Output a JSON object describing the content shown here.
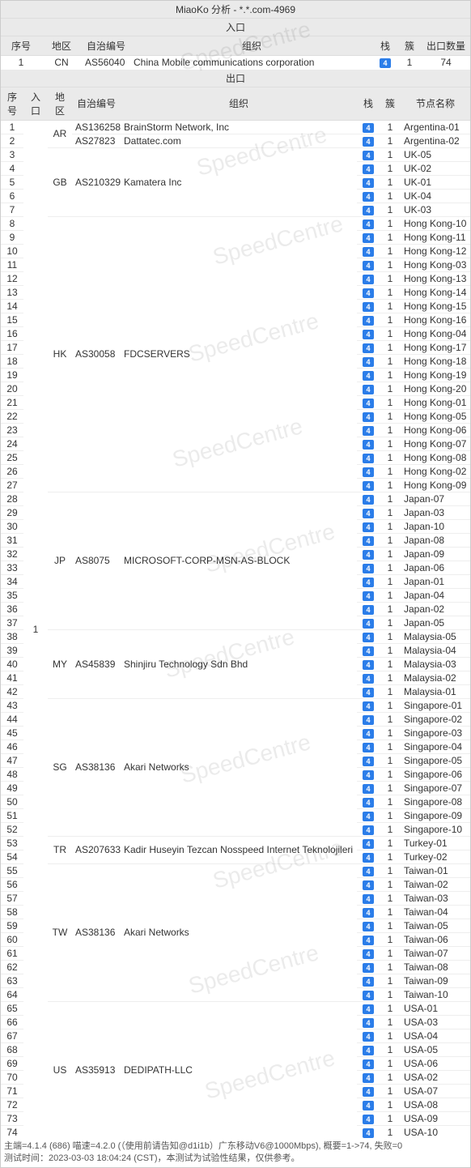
{
  "title": "MiaoKo 分析 - *.*.com-4969",
  "watermark_text": "SpeedCentre",
  "entry_section": {
    "label": "入口"
  },
  "exit_section": {
    "label": "出口"
  },
  "entry_headers": {
    "seq": "序号",
    "region": "地区",
    "asn": "自治编号",
    "org": "组织",
    "stack": "栈",
    "clan": "簇",
    "exit_count": "出口数量"
  },
  "exit_headers": {
    "seq": "序号",
    "entry": "入口",
    "region": "地区",
    "asn": "自治编号",
    "org": "组织",
    "stack": "栈",
    "clan": "簇",
    "node": "节点名称"
  },
  "badge_value": "4",
  "entry_rows": [
    {
      "seq": "1",
      "region": "CN",
      "asn": "AS56040",
      "org": "China Mobile communications corporation",
      "clan": "1",
      "exit_count": "74"
    }
  ],
  "exit_entry_value": "1",
  "region_groups": [
    {
      "region": "AR",
      "subs": [
        {
          "asn": "AS136258",
          "org": "BrainStorm Network, Inc",
          "rows": [
            {
              "seq": "1",
              "clan": "1",
              "node": "Argentina-01"
            }
          ]
        },
        {
          "asn": "AS27823",
          "org": "Dattatec.com",
          "rows": [
            {
              "seq": "2",
              "clan": "1",
              "node": "Argentina-02"
            }
          ]
        }
      ]
    },
    {
      "region": "GB",
      "subs": [
        {
          "asn": "AS210329",
          "org": "Kamatera Inc",
          "rows": [
            {
              "seq": "3",
              "clan": "1",
              "node": "UK-05"
            },
            {
              "seq": "4",
              "clan": "1",
              "node": "UK-02"
            },
            {
              "seq": "5",
              "clan": "1",
              "node": "UK-01"
            },
            {
              "seq": "6",
              "clan": "1",
              "node": "UK-04"
            },
            {
              "seq": "7",
              "clan": "1",
              "node": "UK-03"
            }
          ]
        }
      ]
    },
    {
      "region": "HK",
      "subs": [
        {
          "asn": "AS30058",
          "org": "FDCSERVERS",
          "rows": [
            {
              "seq": "8",
              "clan": "1",
              "node": "Hong Kong-10"
            },
            {
              "seq": "9",
              "clan": "1",
              "node": "Hong Kong-11"
            },
            {
              "seq": "10",
              "clan": "1",
              "node": "Hong Kong-12"
            },
            {
              "seq": "11",
              "clan": "1",
              "node": "Hong Kong-03"
            },
            {
              "seq": "12",
              "clan": "1",
              "node": "Hong Kong-13"
            },
            {
              "seq": "13",
              "clan": "1",
              "node": "Hong Kong-14"
            },
            {
              "seq": "14",
              "clan": "1",
              "node": "Hong Kong-15"
            },
            {
              "seq": "15",
              "clan": "1",
              "node": "Hong Kong-16"
            },
            {
              "seq": "16",
              "clan": "1",
              "node": "Hong Kong-04"
            },
            {
              "seq": "17",
              "clan": "1",
              "node": "Hong Kong-17"
            },
            {
              "seq": "18",
              "clan": "1",
              "node": "Hong Kong-18"
            },
            {
              "seq": "19",
              "clan": "1",
              "node": "Hong Kong-19"
            },
            {
              "seq": "20",
              "clan": "1",
              "node": "Hong Kong-20"
            },
            {
              "seq": "21",
              "clan": "1",
              "node": "Hong Kong-01"
            },
            {
              "seq": "22",
              "clan": "1",
              "node": "Hong Kong-05"
            },
            {
              "seq": "23",
              "clan": "1",
              "node": "Hong Kong-06"
            },
            {
              "seq": "24",
              "clan": "1",
              "node": "Hong Kong-07"
            },
            {
              "seq": "25",
              "clan": "1",
              "node": "Hong Kong-08"
            },
            {
              "seq": "26",
              "clan": "1",
              "node": "Hong Kong-02"
            },
            {
              "seq": "27",
              "clan": "1",
              "node": "Hong Kong-09"
            }
          ]
        }
      ]
    },
    {
      "region": "JP",
      "subs": [
        {
          "asn": "AS8075",
          "org": "MICROSOFT-CORP-MSN-AS-BLOCK",
          "rows": [
            {
              "seq": "28",
              "clan": "1",
              "node": "Japan-07"
            },
            {
              "seq": "29",
              "clan": "1",
              "node": "Japan-03"
            },
            {
              "seq": "30",
              "clan": "1",
              "node": "Japan-10"
            },
            {
              "seq": "31",
              "clan": "1",
              "node": "Japan-08"
            },
            {
              "seq": "32",
              "clan": "1",
              "node": "Japan-09"
            },
            {
              "seq": "33",
              "clan": "1",
              "node": "Japan-06"
            },
            {
              "seq": "34",
              "clan": "1",
              "node": "Japan-01"
            },
            {
              "seq": "35",
              "clan": "1",
              "node": "Japan-04"
            },
            {
              "seq": "36",
              "clan": "1",
              "node": "Japan-02"
            },
            {
              "seq": "37",
              "clan": "1",
              "node": "Japan-05"
            }
          ]
        }
      ]
    },
    {
      "region": "MY",
      "subs": [
        {
          "asn": "AS45839",
          "org": "Shinjiru Technology Sdn Bhd",
          "rows": [
            {
              "seq": "38",
              "clan": "1",
              "node": "Malaysia-05"
            },
            {
              "seq": "39",
              "clan": "1",
              "node": "Malaysia-04"
            },
            {
              "seq": "40",
              "clan": "1",
              "node": "Malaysia-03"
            },
            {
              "seq": "41",
              "clan": "1",
              "node": "Malaysia-02"
            },
            {
              "seq": "42",
              "clan": "1",
              "node": "Malaysia-01"
            }
          ]
        }
      ]
    },
    {
      "region": "SG",
      "subs": [
        {
          "asn": "AS38136",
          "org": "Akari Networks",
          "rows": [
            {
              "seq": "43",
              "clan": "1",
              "node": "Singapore-01"
            },
            {
              "seq": "44",
              "clan": "1",
              "node": "Singapore-02"
            },
            {
              "seq": "45",
              "clan": "1",
              "node": "Singapore-03"
            },
            {
              "seq": "46",
              "clan": "1",
              "node": "Singapore-04"
            },
            {
              "seq": "47",
              "clan": "1",
              "node": "Singapore-05"
            },
            {
              "seq": "48",
              "clan": "1",
              "node": "Singapore-06"
            },
            {
              "seq": "49",
              "clan": "1",
              "node": "Singapore-07"
            },
            {
              "seq": "50",
              "clan": "1",
              "node": "Singapore-08"
            },
            {
              "seq": "51",
              "clan": "1",
              "node": "Singapore-09"
            },
            {
              "seq": "52",
              "clan": "1",
              "node": "Singapore-10"
            }
          ]
        }
      ]
    },
    {
      "region": "TR",
      "subs": [
        {
          "asn": "AS207633",
          "org": "Kadir Huseyin Tezcan Nosspeed Internet Teknolojileri",
          "rows": [
            {
              "seq": "53",
              "clan": "1",
              "node": "Turkey-01"
            },
            {
              "seq": "54",
              "clan": "1",
              "node": "Turkey-02"
            }
          ]
        }
      ]
    },
    {
      "region": "TW",
      "subs": [
        {
          "asn": "AS38136",
          "org": "Akari Networks",
          "rows": [
            {
              "seq": "55",
              "clan": "1",
              "node": "Taiwan-01"
            },
            {
              "seq": "56",
              "clan": "1",
              "node": "Taiwan-02"
            },
            {
              "seq": "57",
              "clan": "1",
              "node": "Taiwan-03"
            },
            {
              "seq": "58",
              "clan": "1",
              "node": "Taiwan-04"
            },
            {
              "seq": "59",
              "clan": "1",
              "node": "Taiwan-05"
            },
            {
              "seq": "60",
              "clan": "1",
              "node": "Taiwan-06"
            },
            {
              "seq": "61",
              "clan": "1",
              "node": "Taiwan-07"
            },
            {
              "seq": "62",
              "clan": "1",
              "node": "Taiwan-08"
            },
            {
              "seq": "63",
              "clan": "1",
              "node": "Taiwan-09"
            },
            {
              "seq": "64",
              "clan": "1",
              "node": "Taiwan-10"
            }
          ]
        }
      ]
    },
    {
      "region": "US",
      "subs": [
        {
          "asn": "AS35913",
          "org": "DEDIPATH-LLC",
          "rows": [
            {
              "seq": "65",
              "clan": "1",
              "node": "USA-01"
            },
            {
              "seq": "66",
              "clan": "1",
              "node": "USA-03"
            },
            {
              "seq": "67",
              "clan": "1",
              "node": "USA-04"
            },
            {
              "seq": "68",
              "clan": "1",
              "node": "USA-05"
            },
            {
              "seq": "69",
              "clan": "1",
              "node": "USA-06"
            },
            {
              "seq": "70",
              "clan": "1",
              "node": "USA-02"
            },
            {
              "seq": "71",
              "clan": "1",
              "node": "USA-07"
            },
            {
              "seq": "72",
              "clan": "1",
              "node": "USA-08"
            },
            {
              "seq": "73",
              "clan": "1",
              "node": "USA-09"
            },
            {
              "seq": "74",
              "clan": "1",
              "node": "USA-10"
            }
          ]
        }
      ]
    }
  ],
  "footer": {
    "line1": "主端=4.1.4 (686) 喵速=4.2.0 (（使用前请告知@d1i1b）广东移动V6@1000Mbps), 概要=1->74, 失败=0",
    "line2": "测试时间：2023-03-03 18:04:24 (CST)，本测试为试验性结果，仅供参考。"
  }
}
